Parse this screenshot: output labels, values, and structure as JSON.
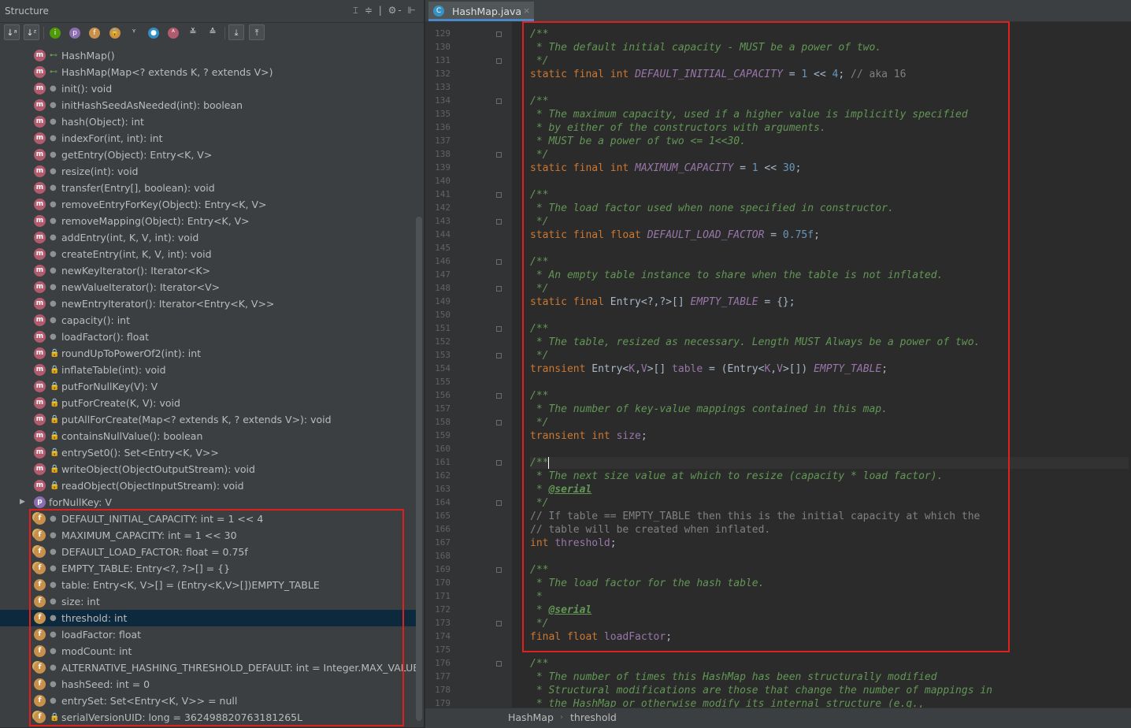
{
  "structure": {
    "title": "Structure",
    "header_icons": "⌶ ≑ | ⚙- ⊩",
    "toolbar": [
      {
        "name": "sort-visibility-button",
        "glyph": "↓ᵃ"
      },
      {
        "name": "sort-alpha-button",
        "glyph": "↓ᶻ"
      },
      {
        "name": "show-inherited-button",
        "glyph": "i"
      },
      {
        "name": "show-properties-button",
        "glyph": "p"
      },
      {
        "name": "show-fields-button",
        "glyph": "f"
      },
      {
        "name": "show-non-public-button",
        "glyph": "🔒"
      },
      {
        "name": "show-lambdas-button",
        "glyph": "ᵞ"
      },
      {
        "name": "show-anonymous-button",
        "glyph": "●"
      },
      {
        "name": "show-abstract-button",
        "glyph": "ᴬ"
      },
      {
        "name": "expand-all-button",
        "glyph": "≚"
      },
      {
        "name": "collapse-all-button",
        "glyph": "≙"
      },
      {
        "name": "autoscroll-to-source-button",
        "glyph": "⤓"
      },
      {
        "name": "autoscroll-from-source-button",
        "glyph": "⤒"
      }
    ],
    "items": [
      {
        "icon": "m",
        "vis": "pub",
        "label": "HashMap()"
      },
      {
        "icon": "m",
        "vis": "pub",
        "label": "HashMap(Map<? extends K, ? extends V>)"
      },
      {
        "icon": "m",
        "vis": "pkg",
        "label": "init(): void"
      },
      {
        "icon": "m",
        "vis": "pkg",
        "label": "initHashSeedAsNeeded(int): boolean"
      },
      {
        "icon": "m",
        "vis": "pkg",
        "label": "hash(Object): int"
      },
      {
        "icon": "m",
        "vis": "pkg",
        "label": "indexFor(int, int): int"
      },
      {
        "icon": "m",
        "vis": "pkg",
        "label": "getEntry(Object): Entry<K, V>"
      },
      {
        "icon": "m",
        "vis": "pkg",
        "label": "resize(int): void"
      },
      {
        "icon": "m",
        "vis": "pkg",
        "label": "transfer(Entry[], boolean): void"
      },
      {
        "icon": "m",
        "vis": "pkg",
        "label": "removeEntryForKey(Object): Entry<K, V>"
      },
      {
        "icon": "m",
        "vis": "pkg",
        "label": "removeMapping(Object): Entry<K, V>"
      },
      {
        "icon": "m",
        "vis": "pkg",
        "label": "addEntry(int, K, V, int): void"
      },
      {
        "icon": "m",
        "vis": "pkg",
        "label": "createEntry(int, K, V, int): void"
      },
      {
        "icon": "m",
        "vis": "pkg",
        "label": "newKeyIterator(): Iterator<K>"
      },
      {
        "icon": "m",
        "vis": "pkg",
        "label": "newValueIterator(): Iterator<V>"
      },
      {
        "icon": "m",
        "vis": "pkg",
        "label": "newEntryIterator(): Iterator<Entry<K, V>>"
      },
      {
        "icon": "m",
        "vis": "pkg",
        "label": "capacity(): int"
      },
      {
        "icon": "m",
        "vis": "pkg",
        "label": "loadFactor(): float"
      },
      {
        "icon": "m",
        "vis": "priv",
        "label": "roundUpToPowerOf2(int): int"
      },
      {
        "icon": "m",
        "vis": "priv",
        "label": "inflateTable(int): void"
      },
      {
        "icon": "m",
        "vis": "priv",
        "label": "putForNullKey(V): V"
      },
      {
        "icon": "m",
        "vis": "priv",
        "label": "putForCreate(K, V): void"
      },
      {
        "icon": "m",
        "vis": "priv",
        "label": "putAllForCreate(Map<? extends K, ? extends V>): void"
      },
      {
        "icon": "m",
        "vis": "priv",
        "label": "containsNullValue(): boolean"
      },
      {
        "icon": "m",
        "vis": "priv",
        "label": "entrySet0(): Set<Entry<K, V>>"
      },
      {
        "icon": "m",
        "vis": "priv",
        "label": "writeObject(ObjectOutputStream): void"
      },
      {
        "icon": "m",
        "vis": "priv",
        "label": "readObject(ObjectInputStream): void"
      },
      {
        "icon": "p",
        "vis": "none",
        "label": "forNullKey: V",
        "expandable": true
      },
      {
        "icon": "sf",
        "vis": "pkg",
        "label": "DEFAULT_INITIAL_CAPACITY: int = 1 << 4"
      },
      {
        "icon": "sf",
        "vis": "pkg",
        "label": "MAXIMUM_CAPACITY: int = 1 << 30"
      },
      {
        "icon": "sf",
        "vis": "pkg",
        "label": "DEFAULT_LOAD_FACTOR: float = 0.75f"
      },
      {
        "icon": "sf",
        "vis": "pkg",
        "label": "EMPTY_TABLE: Entry<?, ?>[] = {}"
      },
      {
        "icon": "f",
        "vis": "pkg",
        "label": "table: Entry<K, V>[] = (Entry<K,V>[])EMPTY_TABLE"
      },
      {
        "icon": "f",
        "vis": "pkg",
        "label": "size: int"
      },
      {
        "icon": "f",
        "vis": "pkg",
        "label": "threshold: int",
        "selected": true
      },
      {
        "icon": "f",
        "vis": "pkg",
        "label": "loadFactor: float"
      },
      {
        "icon": "f",
        "vis": "pkg",
        "label": "modCount: int"
      },
      {
        "icon": "sf",
        "vis": "pkg",
        "label": "ALTERNATIVE_HASHING_THRESHOLD_DEFAULT: int = Integer.MAX_VALUE"
      },
      {
        "icon": "f",
        "vis": "pkg",
        "label": "hashSeed: int = 0"
      },
      {
        "icon": "f",
        "vis": "pkg",
        "label": "entrySet: Set<Entry<K, V>> = null"
      },
      {
        "icon": "sf",
        "vis": "priv",
        "label": "serialVersionUID: long = 362498820763181265L"
      }
    ]
  },
  "editor": {
    "tab_label": "HashMap.java",
    "tab_close": "×",
    "breadcrumb": {
      "class": "HashMap",
      "sep": "›",
      "field": "threshold"
    },
    "line_start": 129,
    "lines": [
      [
        [
          "doc",
          "/**"
        ]
      ],
      [
        [
          "doc",
          " * The default initial capacity - MUST be a power of two."
        ]
      ],
      [
        [
          "doc",
          " */"
        ]
      ],
      [
        [
          "kw",
          "static final int "
        ],
        [
          "st",
          "DEFAULT_INITIAL_CAPACITY"
        ],
        [
          "pl",
          " = "
        ],
        [
          "num",
          "1"
        ],
        [
          "pl",
          " << "
        ],
        [
          "num",
          "4"
        ],
        [
          "pl",
          "; "
        ],
        [
          "cm",
          "// aka 16"
        ]
      ],
      [
        [
          "pl",
          ""
        ]
      ],
      [
        [
          "doc",
          "/**"
        ]
      ],
      [
        [
          "doc",
          " * The maximum capacity, used if a higher value is implicitly specified"
        ]
      ],
      [
        [
          "doc",
          " * by either of the constructors with arguments."
        ]
      ],
      [
        [
          "doc",
          " * MUST be a power of two <= 1<<30."
        ]
      ],
      [
        [
          "doc",
          " */"
        ]
      ],
      [
        [
          "kw",
          "static final int "
        ],
        [
          "st",
          "MAXIMUM_CAPACITY"
        ],
        [
          "pl",
          " = "
        ],
        [
          "num",
          "1"
        ],
        [
          "pl",
          " << "
        ],
        [
          "num",
          "30"
        ],
        [
          "pl",
          ";"
        ]
      ],
      [
        [
          "pl",
          ""
        ]
      ],
      [
        [
          "doc",
          "/**"
        ]
      ],
      [
        [
          "doc",
          " * The load factor used when none specified in constructor."
        ]
      ],
      [
        [
          "doc",
          " */"
        ]
      ],
      [
        [
          "kw",
          "static final float "
        ],
        [
          "st",
          "DEFAULT_LOAD_FACTOR"
        ],
        [
          "pl",
          " = "
        ],
        [
          "num",
          "0.75f"
        ],
        [
          "pl",
          ";"
        ]
      ],
      [
        [
          "pl",
          ""
        ]
      ],
      [
        [
          "doc",
          "/**"
        ]
      ],
      [
        [
          "doc",
          " * An empty table instance to share when the table is not inflated."
        ]
      ],
      [
        [
          "doc",
          " */"
        ]
      ],
      [
        [
          "kw",
          "static final "
        ],
        [
          "pl",
          "Entry<?,?>[] "
        ],
        [
          "st",
          "EMPTY_TABLE"
        ],
        [
          "pl",
          " = {};"
        ]
      ],
      [
        [
          "pl",
          ""
        ]
      ],
      [
        [
          "doc",
          "/**"
        ]
      ],
      [
        [
          "doc",
          " * The table, resized as necessary. Length MUST Always be a power of two."
        ]
      ],
      [
        [
          "doc",
          " */"
        ]
      ],
      [
        [
          "kw",
          "transient "
        ],
        [
          "pl",
          "Entry<"
        ],
        [
          "tp",
          "K"
        ],
        [
          "pl",
          ","
        ],
        [
          "tp",
          "V"
        ],
        [
          "pl",
          ">[] "
        ],
        [
          "fd",
          "table"
        ],
        [
          "pl",
          " = (Entry<"
        ],
        [
          "tp",
          "K"
        ],
        [
          "pl",
          ","
        ],
        [
          "tp",
          "V"
        ],
        [
          "pl",
          ">[]) "
        ],
        [
          "st",
          "EMPTY_TABLE"
        ],
        [
          "pl",
          ";"
        ]
      ],
      [
        [
          "pl",
          ""
        ]
      ],
      [
        [
          "doc",
          "/**"
        ]
      ],
      [
        [
          "doc",
          " * The number of key-value mappings contained in this map."
        ]
      ],
      [
        [
          "doc",
          " */"
        ]
      ],
      [
        [
          "kw",
          "transient int "
        ],
        [
          "fd",
          "size"
        ],
        [
          "pl",
          ";"
        ]
      ],
      [
        [
          "pl",
          ""
        ]
      ],
      [
        [
          "doc",
          "/**"
        ],
        [
          "caret",
          ""
        ]
      ],
      [
        [
          "doc",
          " * The next size value at which to resize (capacity * load factor)."
        ]
      ],
      [
        [
          "doc",
          " * "
        ],
        [
          "tag",
          "@serial"
        ]
      ],
      [
        [
          "doc",
          " */"
        ]
      ],
      [
        [
          "cm",
          "// If table == EMPTY_TABLE then this is the initial capacity at which the"
        ]
      ],
      [
        [
          "cm",
          "// table will be created when inflated."
        ]
      ],
      [
        [
          "kw",
          "int "
        ],
        [
          "fd",
          "threshold"
        ],
        [
          "pl",
          ";"
        ]
      ],
      [
        [
          "pl",
          ""
        ]
      ],
      [
        [
          "doc",
          "/**"
        ]
      ],
      [
        [
          "doc",
          " * The load factor for the hash table."
        ]
      ],
      [
        [
          "doc",
          " *"
        ]
      ],
      [
        [
          "doc",
          " * "
        ],
        [
          "tag",
          "@serial"
        ]
      ],
      [
        [
          "doc",
          " */"
        ]
      ],
      [
        [
          "kw",
          "final float "
        ],
        [
          "fd",
          "loadFactor"
        ],
        [
          "pl",
          ";"
        ]
      ],
      [
        [
          "pl",
          ""
        ]
      ],
      [
        [
          "doc",
          "/**"
        ]
      ],
      [
        [
          "doc",
          " * The number of times this HashMap has been structurally modified"
        ]
      ],
      [
        [
          "doc",
          " * Structural modifications are those that change the number of mappings in"
        ]
      ],
      [
        [
          "doc",
          " * the HashMap or otherwise modify its internal structure (e.g.,"
        ]
      ]
    ]
  }
}
